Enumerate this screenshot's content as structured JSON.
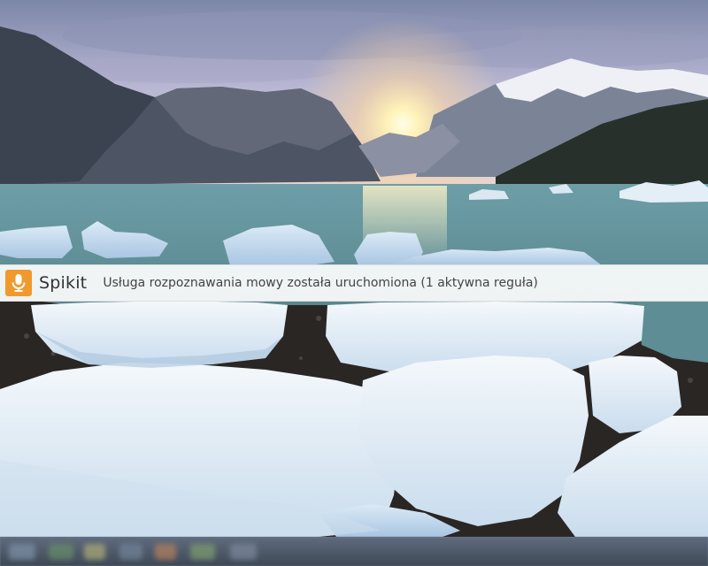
{
  "notification": {
    "app_name": "Spikit",
    "message": "Usługa rozpoznawania mowy została uruchomiona (1 aktywna reguła)",
    "icon": "microphone-icon",
    "icon_color": "#f09a2e"
  },
  "desktop": {
    "wallpaper": "glacier-bay-sunset-icebergs"
  }
}
